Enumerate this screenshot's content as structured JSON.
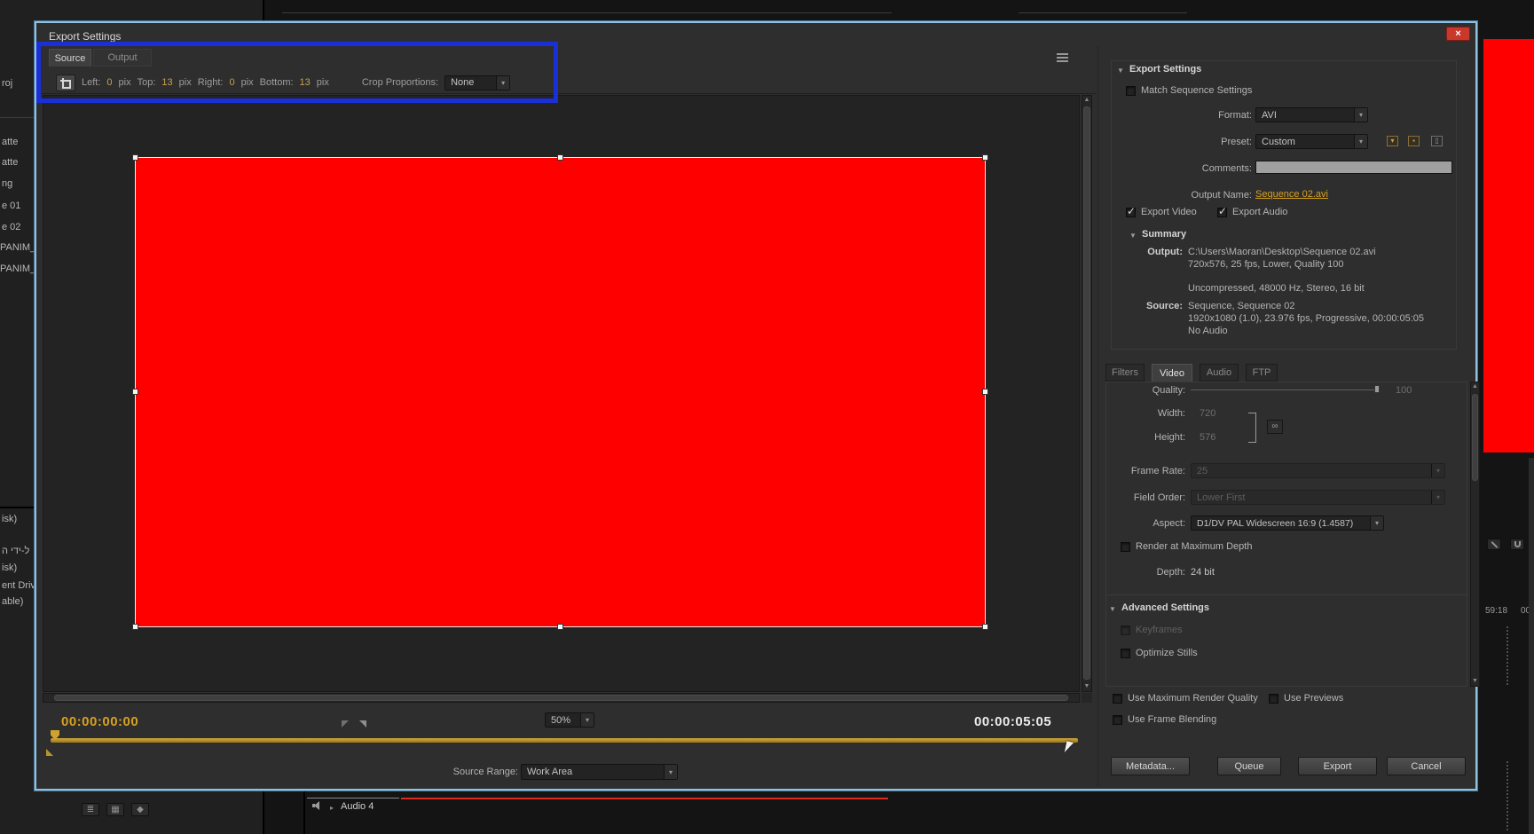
{
  "dialog": {
    "title": "Export Settings",
    "view_tabs": {
      "source": "Source",
      "output": "Output"
    },
    "crop_bar": {
      "left_label": "Left:",
      "left_value": "0",
      "top_label": "Top:",
      "top_value": "13",
      "right_label": "Right:",
      "right_value": "0",
      "bottom_label": "Bottom:",
      "bottom_value": "13",
      "pix_unit": "pix",
      "proportions_label": "Crop Proportions:",
      "proportions_value": "None"
    },
    "preview": {
      "current_timecode": "00:00:00:00",
      "duration_timecode": "00:00:05:05",
      "zoom_level": "50%",
      "source_range_label": "Source Range:",
      "source_range_value": "Work Area"
    },
    "settings": {
      "header": "Export Settings",
      "match_sequence_label": "Match Sequence Settings",
      "format_label": "Format:",
      "format_value": "AVI",
      "preset_label": "Preset:",
      "preset_value": "Custom",
      "comments_label": "Comments:",
      "output_name_label": "Output Name:",
      "output_name_value": "Sequence 02.avi",
      "export_video_label": "Export Video",
      "export_audio_label": "Export Audio"
    },
    "summary": {
      "header": "Summary",
      "output_label": "Output:",
      "output_line1": "C:\\Users\\Maoran\\Desktop\\Sequence 02.avi",
      "output_line2": "720x576, 25 fps, Lower, Quality 100",
      "output_line3": "Uncompressed, 48000 Hz, Stereo, 16 bit",
      "source_label": "Source:",
      "source_line1": "Sequence, Sequence 02",
      "source_line2": "1920x1080 (1.0), 23.976 fps, Progressive, 00:00:05:05",
      "source_line3": "No Audio"
    },
    "option_tabs": {
      "filters": "Filters",
      "video": "Video",
      "audio": "Audio",
      "ftp": "FTP"
    },
    "video_options": {
      "quality_label": "Quality:",
      "quality_value": "100",
      "width_label": "Width:",
      "width_value": "720",
      "height_label": "Height:",
      "height_value": "576",
      "frame_rate_label": "Frame Rate:",
      "frame_rate_value": "25",
      "field_order_label": "Field Order:",
      "field_order_value": "Lower First",
      "aspect_label": "Aspect:",
      "aspect_value": "D1/DV PAL Widescreen 16:9 (1.4587)",
      "render_max_depth_label": "Render at Maximum Depth",
      "depth_label": "Depth:",
      "depth_value": "24 bit",
      "advanced_header": "Advanced Settings",
      "keyframes_label": "Keyframes",
      "optimize_stills_label": "Optimize Stills"
    },
    "footer": {
      "use_max_quality_label": "Use Maximum Render Quality",
      "use_previews_label": "Use Previews",
      "use_frame_blending_label": "Use Frame Blending",
      "metadata_button": "Metadata...",
      "queue_button": "Queue",
      "export_button": "Export",
      "cancel_button": "Cancel"
    }
  },
  "background": {
    "left_panel_items": [
      "roj",
      "atte",
      "atte",
      "ng",
      "e 01",
      "e 02",
      "PANIM_I",
      "PANIM_I"
    ],
    "left_lower_items": [
      "isk)",
      "ל-ידי ה",
      "isk)",
      "ent Driv",
      "able)"
    ],
    "audio_track_label": "Audio 4",
    "right_timecode_a": "59:18",
    "right_timecode_b": "00"
  }
}
